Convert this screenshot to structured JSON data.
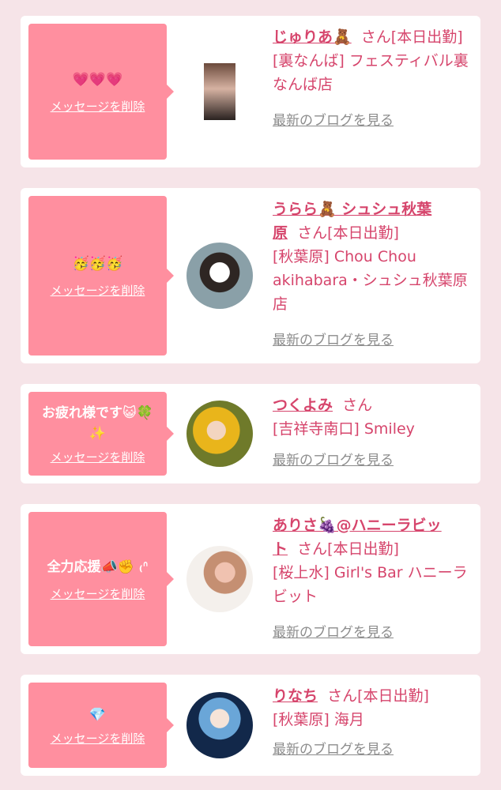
{
  "cards": [
    {
      "message": "💗💗💗",
      "delete_label": "メッセージを削除",
      "name": "じゅりあ🧸",
      "san": "さん",
      "status": "[本日出勤]",
      "shop": "[裏なんば] フェスティバル裏なんば店",
      "blog_label": "最新のブログを見る"
    },
    {
      "message": "🥳🥳🥳",
      "delete_label": "メッセージを削除",
      "name": "うらら🧸 シュシュ秋葉原",
      "san": "さん",
      "status": "[本日出勤]",
      "shop": "[秋葉原] Chou Chou akihabara・シュシュ秋葉原店",
      "blog_label": "最新のブログを見る"
    },
    {
      "message": "お疲れ様です😺🍀✨",
      "delete_label": "メッセージを削除",
      "name": "つくよみ",
      "san": "さん",
      "status": "",
      "shop": "[吉祥寺南口] Smiley",
      "blog_label": "最新のブログを見る"
    },
    {
      "message": "全力応援📣✊ ₍ᐢ",
      "delete_label": "メッセージを削除",
      "name": "ありさ🍇@ハニーラビット",
      "san": "さん",
      "status": "[本日出勤]",
      "shop": "[桜上水] Girl's Bar ハニーラビット",
      "blog_label": "最新のブログを見る"
    },
    {
      "message": "💎",
      "delete_label": "メッセージを削除",
      "name": "りなち",
      "san": "さん",
      "status": "[本日出勤]",
      "shop": "[秋葉原] 海月",
      "blog_label": "最新のブログを見る"
    }
  ]
}
